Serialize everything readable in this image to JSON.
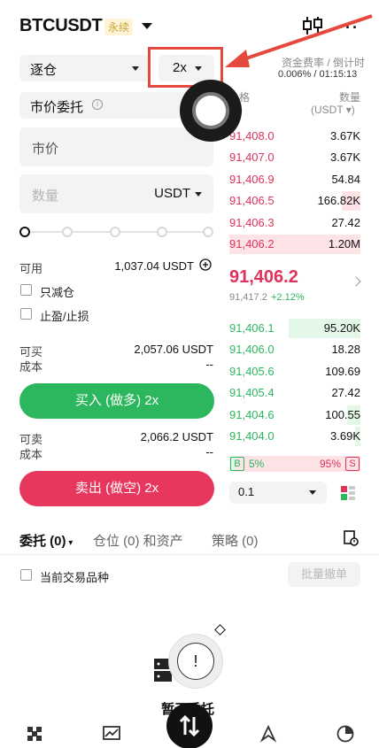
{
  "header": {
    "symbol": "BTCUSDT",
    "contract_tag": "永续"
  },
  "form": {
    "margin_mode": "逐仓",
    "leverage": "2x",
    "order_type": "市价委托",
    "info_glyph": "i",
    "price_label": "市价",
    "qty_placeholder": "数量",
    "qty_unit": "USDT",
    "slider_percent": 0,
    "available_label": "可用",
    "available_value": "1,037.04 USDT",
    "reduce_only_label": "只减仓",
    "tpsl_label": "止盈/止损",
    "can_buy_label": "可买",
    "can_buy_value": "2,057.06 USDT",
    "cost_label": "成本",
    "cost_buy_value": "--",
    "buy_button": "买入 (做多) 2x",
    "can_sell_label": "可卖",
    "can_sell_value": "2,066.2 USDT",
    "cost_sell_value": "--",
    "sell_button": "卖出 (做空) 2x"
  },
  "orderbook": {
    "funding_label": "资金费率 / 倒计时",
    "funding_value": "0.006% / 01:15:13",
    "price_header": "格",
    "qty_header": "数量",
    "qty_unit_header": "(USDT",
    "price_unit_header": ")",
    "asks": [
      {
        "price": "91,408.0",
        "qty": "3.67K",
        "depth": 0.0
      },
      {
        "price": "91,407.0",
        "qty": "3.67K",
        "depth": 0.0
      },
      {
        "price": "91,406.9",
        "qty": "54.84",
        "depth": 0.0
      },
      {
        "price": "91,406.5",
        "qty": "166.82K",
        "depth": 0.14
      },
      {
        "price": "91,406.3",
        "qty": "27.42",
        "depth": 0.0
      },
      {
        "price": "91,406.2",
        "qty": "1.20M",
        "depth": 1.0
      }
    ],
    "last_price": "91,406.2",
    "mark_price": "91,417.2",
    "change_pct": "+2.12%",
    "bids": [
      {
        "price": "91,406.1",
        "qty": "95.20K",
        "depth": 0.55
      },
      {
        "price": "91,406.0",
        "qty": "18.28",
        "depth": 0.0
      },
      {
        "price": "91,405.6",
        "qty": "109.69",
        "depth": 0.0
      },
      {
        "price": "91,405.4",
        "qty": "27.42",
        "depth": 0.0
      },
      {
        "price": "91,404.6",
        "qty": "100.55",
        "depth": 0.1
      },
      {
        "price": "91,404.0",
        "qty": "3.69K",
        "depth": 0.04
      }
    ],
    "buy_ratio": "5%",
    "sell_ratio": "95%",
    "buy_ratio_value": 0.05,
    "badge_b": "B",
    "badge_s": "S",
    "depth_step": "0.1"
  },
  "tabs": {
    "orders": "委托 (0)",
    "positions": "仓位 (0) 和资产",
    "strategy": "策略 (0)",
    "current_symbol_label": "当前交易品种",
    "cancel_all": "批量撤单"
  },
  "empty_state": {
    "text": "暂无委托"
  },
  "colors": {
    "buy": "#2cb75e",
    "sell": "#e8375c",
    "highlight": "#e5483c"
  }
}
